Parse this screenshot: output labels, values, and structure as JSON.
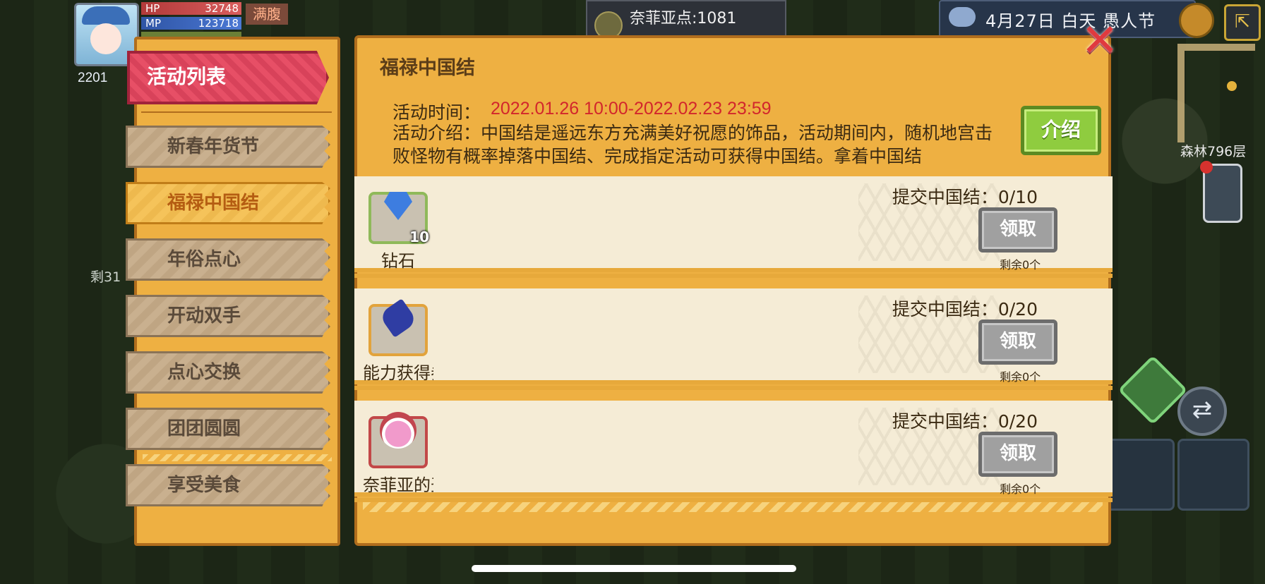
{
  "hud": {
    "hp_label": "HP",
    "hp_value": "32748",
    "mp_label": "MP",
    "mp_value": "123718",
    "status_badge": "满腹",
    "gem_count": "2201",
    "left_remaining": "剩31",
    "nafy_points": "奈菲亚点:1081",
    "date_text": "4月27日  白天  愚人节",
    "forest_floor": "森林796层"
  },
  "activity_list": {
    "title": "活动列表",
    "items": [
      {
        "label": "新春年货节"
      },
      {
        "label": "福禄中国结"
      },
      {
        "label": "年俗点心"
      },
      {
        "label": "开动双手"
      },
      {
        "label": "点心交换"
      },
      {
        "label": "团团圆圆"
      },
      {
        "label": "享受美食"
      }
    ],
    "active_index": 1
  },
  "event": {
    "title": "福禄中国结",
    "time_label": "活动时间：",
    "time_value": "2022.01.26 10:00-2022.02.23 23:59",
    "description": "活动介绍：中国结是遥远东方充满美好祝愿的饰品，活动期间内，随机地宫击败怪物有概率掉落中国结、完成指定活动可获得中国结。拿着中国结",
    "intro_button": "介绍",
    "close_symbol": "✕"
  },
  "rewards": [
    {
      "name": "钻石",
      "count": "10",
      "requirement": "提交中国结：0/10",
      "claim_label": "领取",
      "remaining": "剩余0个",
      "icon": "diamond-icon",
      "frame": "green"
    },
    {
      "name": "能力获得券",
      "count": "",
      "requirement": "提交中国结：0/20",
      "claim_label": "领取",
      "remaining": "剩余0个",
      "icon": "scroll-icon",
      "frame": "orange"
    },
    {
      "name": "奈菲亚的圣辉",
      "count": "",
      "requirement": "提交中国结：0/20",
      "claim_label": "领取",
      "remaining": "剩余0个",
      "icon": "potion-icon",
      "frame": "red"
    }
  ],
  "colors": {
    "accent": "#eeb042",
    "title_red": "#e74f66",
    "time_red": "#d2262c",
    "intro_green": "#8fcc3f"
  }
}
